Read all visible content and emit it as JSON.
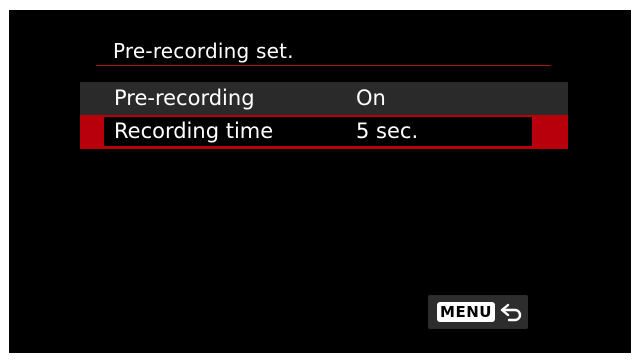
{
  "menu": {
    "title": "Pre-recording set.",
    "items": [
      {
        "label": "Pre-recording",
        "value": "On",
        "selected": false
      },
      {
        "label": "Recording time",
        "value": "5 sec.",
        "selected": true
      }
    ]
  },
  "footer": {
    "menu_label": "MENU",
    "back_icon": "return-arrow-icon"
  },
  "colors": {
    "background": "#000000",
    "selection": "#b8000d",
    "row_highlight": "#2a2a2a",
    "text": "#ffffff"
  }
}
